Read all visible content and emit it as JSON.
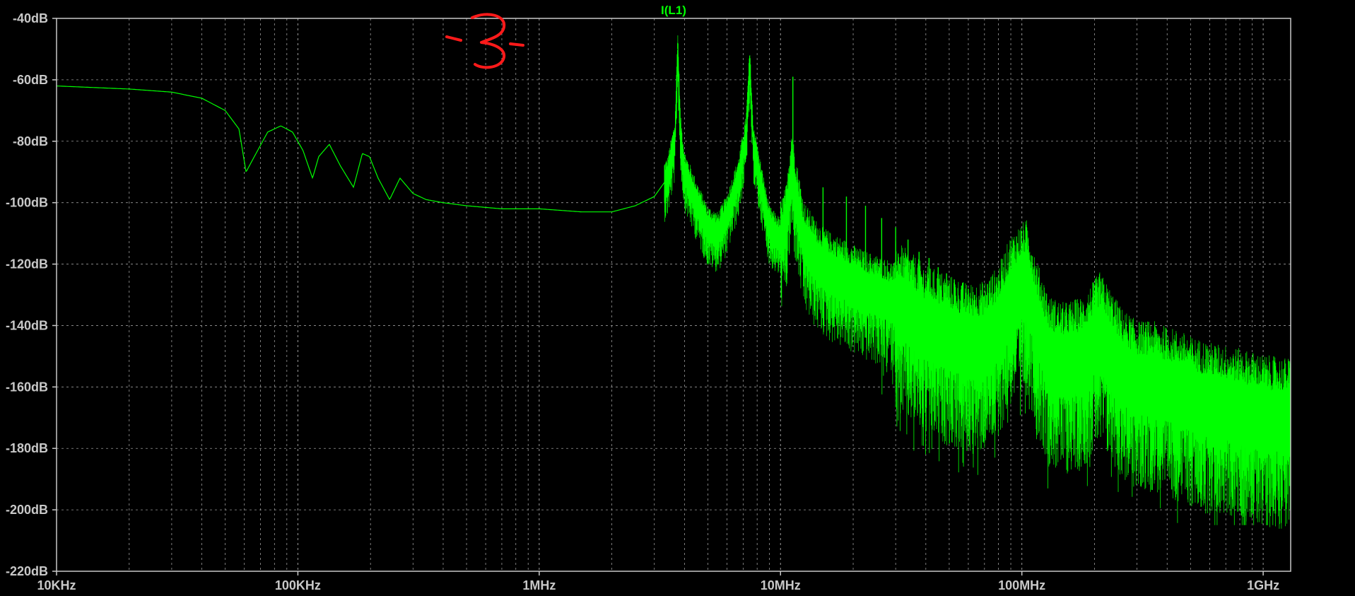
{
  "window": {
    "background": "#000000"
  },
  "chart_data": {
    "type": "line",
    "title": "I(L1)",
    "xlabel": "",
    "ylabel": "",
    "x_scale": "log",
    "x_unit": "Hz",
    "xlim": [
      10000,
      1300000000
    ],
    "ylim": [
      -220,
      -40
    ],
    "y_unit": "dB",
    "grid": true,
    "x_tick_values": [
      10000,
      100000,
      1000000,
      10000000,
      100000000,
      1000000000
    ],
    "x_tick_labels": [
      "10KHz",
      "100KHz",
      "1MHz",
      "10MHz",
      "100MHz",
      "1GHz"
    ],
    "y_tick_values": [
      -40,
      -60,
      -80,
      -100,
      -120,
      -140,
      -160,
      -180,
      -200,
      -220
    ],
    "y_tick_labels": [
      "-40dB",
      "-60dB",
      "-80dB",
      "-100dB",
      "-120dB",
      "-140dB",
      "-160dB",
      "-180dB",
      "-200dB",
      "-220dB"
    ],
    "colors": {
      "trace": "#00ff00",
      "title": "#00ff00",
      "grid": "#9a9a9a",
      "frame": "#c8c8c8",
      "annotation": "#ff1a1a"
    },
    "annotation_text": "-3-",
    "series": [
      {
        "name": "I(L1)",
        "x": [
          10000,
          20000,
          30000,
          40000,
          50000,
          57000,
          61000,
          66000,
          75000,
          85000,
          95000,
          105000,
          115000,
          118000,
          122000,
          135000,
          150000,
          170000,
          185000,
          198000,
          215000,
          240000,
          265000,
          300000,
          340000,
          400000,
          500000,
          700000,
          1000000,
          1500000,
          2000000,
          2500000,
          3000000,
          3400000,
          3650000,
          3750000,
          3850000,
          4000000,
          4500000,
          5000000,
          5500000,
          6000000,
          6700000,
          7200000,
          7450000,
          7700000,
          8200000,
          9000000,
          10000000,
          10600000,
          11100000,
          11600000,
          12500000,
          14000000,
          16000000,
          19000000,
          22000000,
          26000000,
          30000000,
          35000000,
          40000000,
          50000000,
          60000000,
          70000000,
          80000000,
          90000000,
          100000000,
          105000000,
          115000000,
          130000000,
          150000000,
          180000000,
          210000000,
          230000000,
          260000000,
          300000000,
          350000000,
          400000000,
          450000000,
          500000000,
          600000000,
          700000000,
          800000000,
          1000000000,
          1200000000,
          1300000000
        ],
        "y": [
          -62,
          -63,
          -64,
          -66,
          -70,
          -76,
          -90,
          -85,
          -77,
          -75,
          -77,
          -83,
          -92,
          -89,
          -85,
          -81,
          -88,
          -95,
          -84,
          -85,
          -92,
          -99,
          -92,
          -97,
          -99,
          -100,
          -101,
          -102,
          -102,
          -103,
          -103,
          -101,
          -98,
          -92,
          -80,
          -50,
          -78,
          -90,
          -100,
          -108,
          -110,
          -104,
          -92,
          -78,
          -56,
          -80,
          -92,
          -108,
          -112,
          -106,
          -88,
          -98,
          -112,
          -118,
          -122,
          -125,
          -128,
          -130,
          -132,
          -136,
          -140,
          -143,
          -146,
          -145,
          -140,
          -130,
          -126,
          -125,
          -138,
          -150,
          -152,
          -150,
          -142,
          -147,
          -154,
          -158,
          -158,
          -160,
          -161,
          -163,
          -165,
          -166,
          -167,
          -169,
          -170,
          -170
        ]
      }
    ],
    "spike_frequencies": [
      3750000,
      7500000,
      11250000,
      15000000,
      18750000,
      22500000,
      26250000,
      30000000,
      33750000,
      37500000,
      41250000,
      45000000,
      48750000,
      52500000,
      56250000,
      60000000,
      63750000,
      67500000,
      71250000,
      75000000,
      78750000,
      82500000,
      86250000,
      90000000,
      93750000,
      97500000,
      101250000,
      105000000,
      108750000,
      112500000,
      116250000,
      120000000,
      123750000,
      127500000,
      131250000,
      135000000,
      138750000,
      142500000,
      146250000,
      150000000
    ],
    "spike_peaks_db": [
      -48,
      -55,
      -59,
      -95,
      -98,
      -101,
      -105,
      -108,
      -112,
      -116,
      -118,
      -121,
      -123,
      -125,
      -127,
      -128,
      -130,
      -131,
      -132,
      -134,
      -135,
      -136,
      -137,
      -137,
      -138,
      -139,
      -140,
      -141,
      -142,
      -142,
      -143,
      -144,
      -145,
      -146,
      -147,
      -148,
      -149,
      -150,
      -151,
      -152
    ]
  }
}
